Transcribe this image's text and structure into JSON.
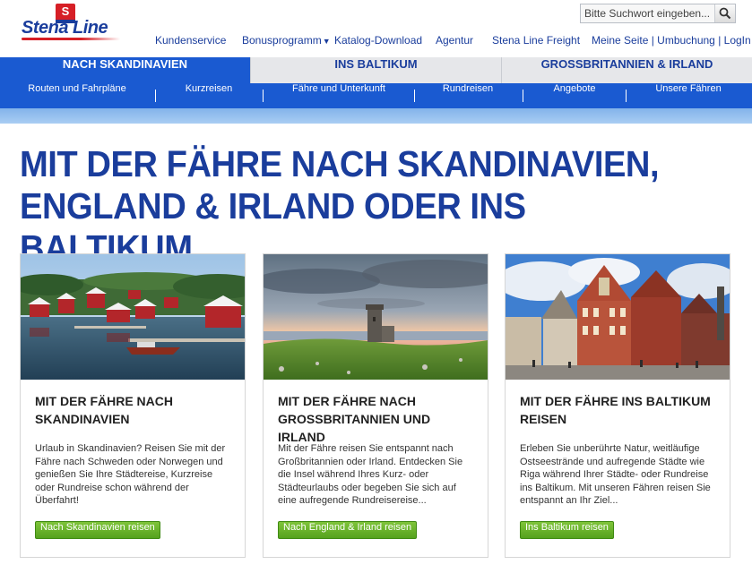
{
  "brand": {
    "logo_letter": "S",
    "logo_text": "Stena Line"
  },
  "search": {
    "placeholder": "Bitte Suchwort eingeben..."
  },
  "topnav": {
    "items": [
      {
        "label": "Kundenservice"
      },
      {
        "label": "Bonusprogramm",
        "caret": "▼"
      },
      {
        "label": "Katalog-Download"
      },
      {
        "label": "Agentur"
      },
      {
        "label": "Stena Line Freight"
      },
      {
        "label": "Meine Seite | Umbuchung | LogIn",
        "caret": "▼"
      }
    ]
  },
  "mainnav": {
    "tabs": [
      {
        "label": "NACH SKANDINAVIEN",
        "active": true
      },
      {
        "label": "INS BALTIKUM",
        "active": false
      },
      {
        "label": "GROSSBRITANNIEN & IRLAND",
        "active": false
      }
    ]
  },
  "subnav": {
    "items": [
      {
        "label": "Routen und Fahrpläne"
      },
      {
        "label": "Kurzreisen"
      },
      {
        "label": "Fähre und Unterkunft"
      },
      {
        "label": "Rundreisen"
      },
      {
        "label": "Angebote"
      },
      {
        "label": "Unsere Fähren"
      }
    ]
  },
  "headline": "MIT DER FÄHRE NACH SKANDINAVIEN, ENGLAND & IRLAND ODER INS BALTIKUM",
  "cards": [
    {
      "title": "MIT DER FÄHRE NACH SKANDINAVIEN",
      "text": "Urlaub in Skandinavien? Reisen Sie mit der Fähre nach Schweden oder Norwegen und genießen Sie Ihre Städtereise, Kurzreise oder Rundreise schon während der Überfahrt!",
      "button": "Nach Skandinavien reisen"
    },
    {
      "title": "MIT DER FÄHRE NACH GROSSBRITANNIEN UND IRLAND",
      "text": "Mit der Fähre reisen Sie entspannt nach Großbritannien oder Irland. Entdecken Sie die Insel während Ihres Kurz- oder Städteurlaubs oder begeben Sie sich auf eine aufregende Rundreisereise...",
      "button": "Nach England & Irland reisen"
    },
    {
      "title": "MIT DER FÄHRE INS BALTIKUM REISEN",
      "text": "Erleben Sie unberührte Natur, weitläufige Ostseestrände und aufregende Städte wie Riga während Ihrer Städte- oder Rundreise ins Baltikum. Mit unseren Fähren reisen Sie entspannt an Ihr Ziel...",
      "button": "Ins Baltikum reisen"
    }
  ],
  "colors": {
    "brand_blue": "#1a3d9c",
    "nav_blue": "#1a5ad1",
    "accent_red": "#d61f26",
    "button_green": "#5fab24"
  }
}
